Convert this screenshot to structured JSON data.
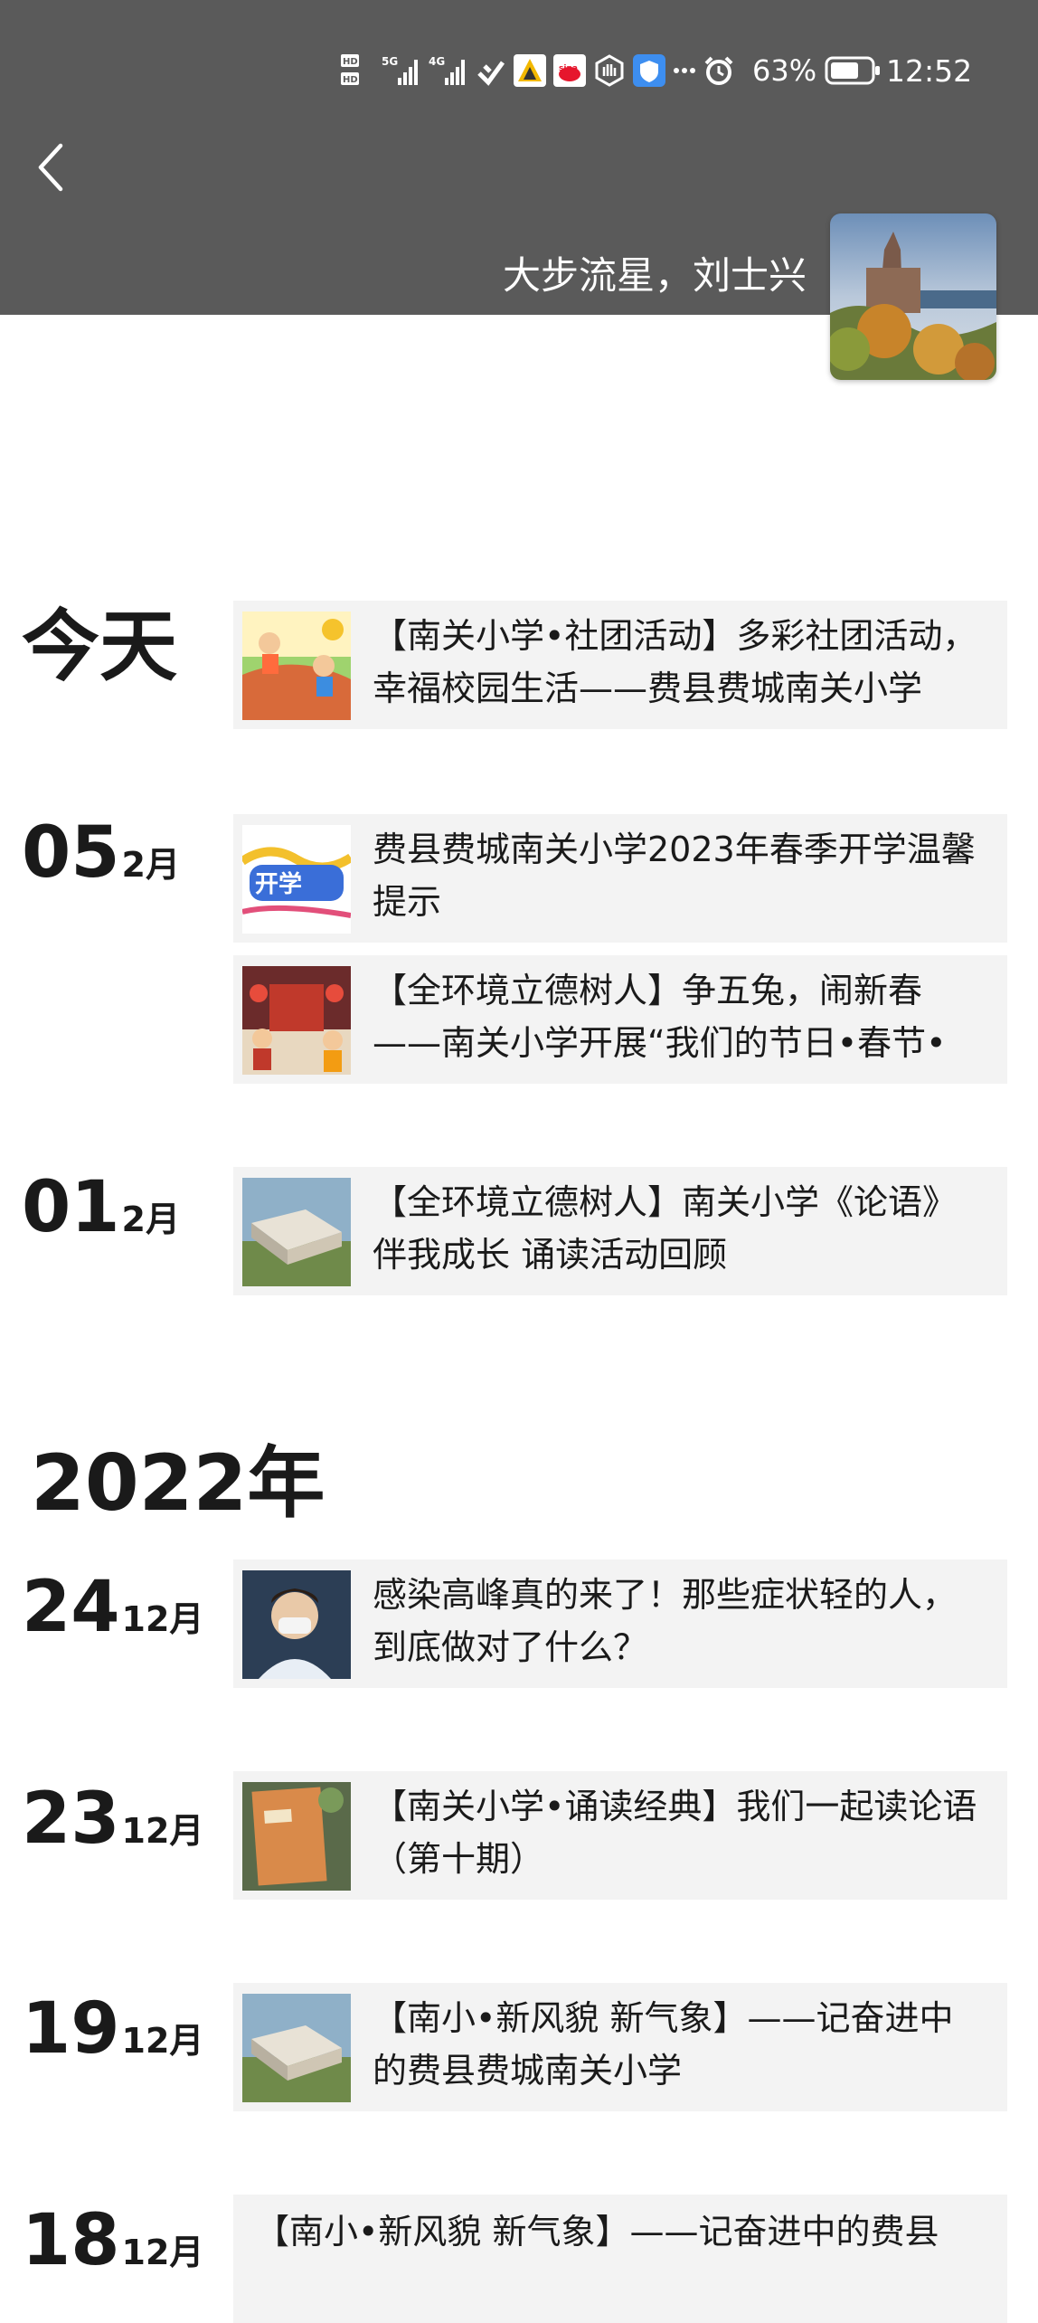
{
  "status_bar": {
    "battery_pct": "63%",
    "time": "12:52",
    "icons": [
      "hd-icon",
      "signal-5g-icon",
      "signal-4g-icon",
      "wifi-icon",
      "app-icon-yellow",
      "weibo-icon",
      "hand-icon",
      "shield-icon",
      "more-dots-icon",
      "alarm-icon",
      "battery-icon"
    ]
  },
  "header": {
    "nickname": "大步流星，刘士兴"
  },
  "timeline": {
    "today_label": "今天",
    "year_label": "2022年",
    "groups": [
      {
        "day": "",
        "month": "",
        "posts": [
          {
            "text": "【南关小学•社团活动】多彩社团活动，幸福校园生活——费县费城南关小学"
          }
        ]
      },
      {
        "day": "05",
        "month": "2月",
        "posts": [
          {
            "text": "费县费城南关小学2023年春季开学温馨提示"
          },
          {
            "text": "【全环境立德树人】争五兔，闹新春——南关小学开展“我们的节日•春节•"
          }
        ]
      },
      {
        "day": "01",
        "month": "2月",
        "posts": [
          {
            "text": "【全环境立德树人】南关小学《论语》伴我成长 诵读活动回顾"
          }
        ]
      },
      {
        "day": "24",
        "month": "12月",
        "posts": [
          {
            "text": "感染高峰真的来了！那些症状轻的人，到底做对了什么？"
          }
        ]
      },
      {
        "day": "23",
        "month": "12月",
        "posts": [
          {
            "text": "【南关小学•诵读经典】我们一起读论语（第十期）"
          }
        ]
      },
      {
        "day": "19",
        "month": "12月",
        "posts": [
          {
            "text": "【南小•新风貌 新气象】——记奋进中的费县费城南关小学"
          }
        ]
      },
      {
        "day": "18",
        "month": "12月",
        "posts": [
          {
            "text": "【南小•新风貌 新气象】——记奋进中的费县"
          }
        ]
      }
    ]
  },
  "colors": {
    "header_bg": "#5a5a5a",
    "card_bg": "#f3f3f3",
    "text": "#1a1a1a"
  }
}
